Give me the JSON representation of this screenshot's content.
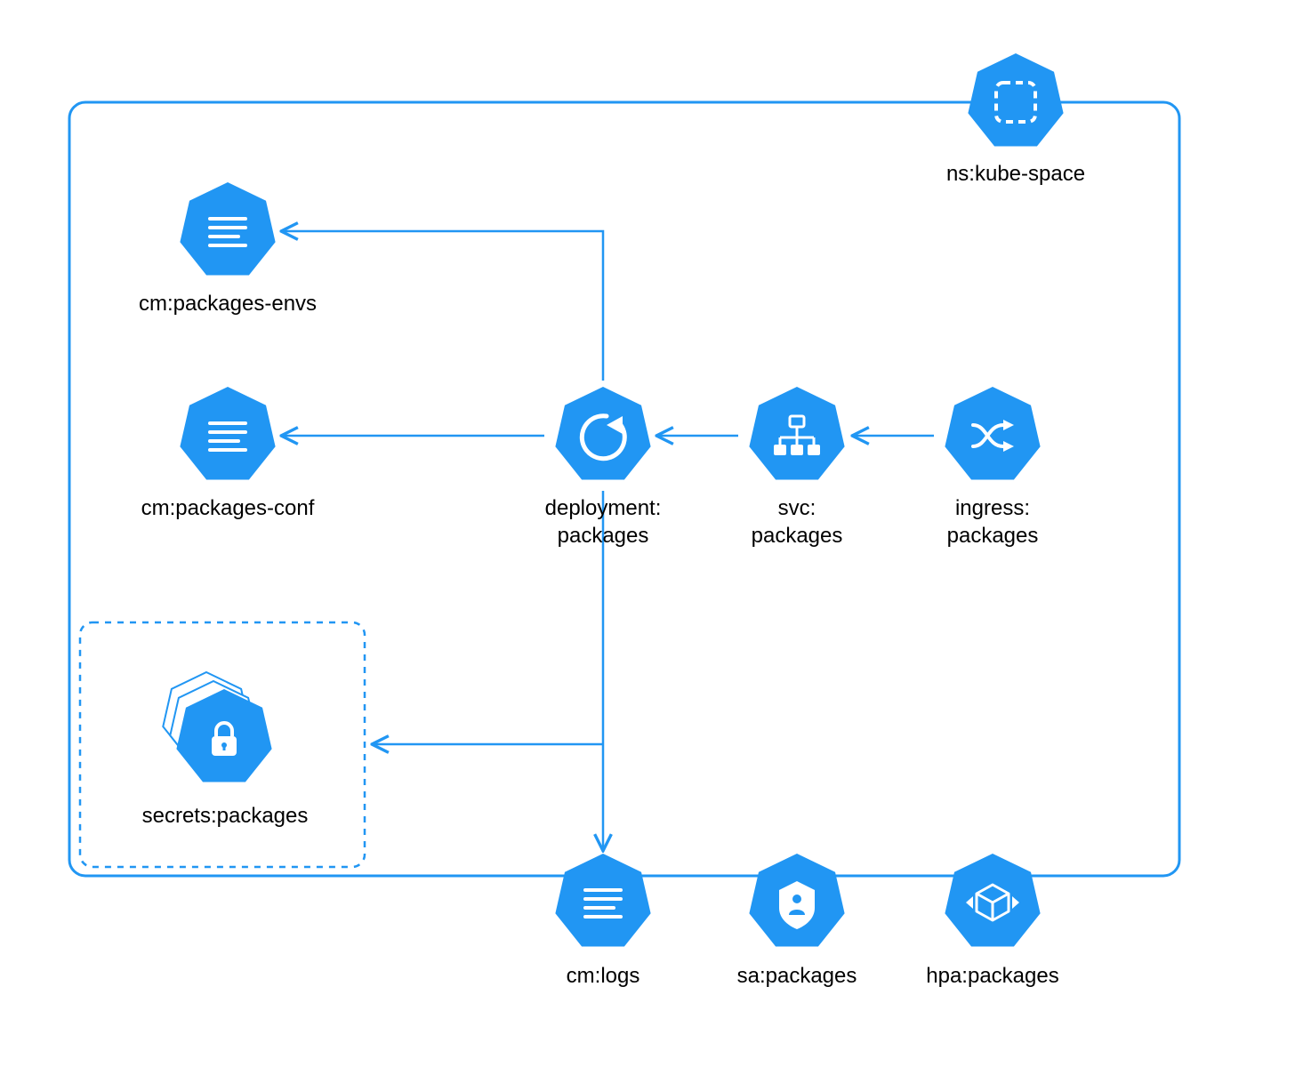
{
  "colors": {
    "blue": "#2196F3",
    "line": "#2196F3"
  },
  "nodes": {
    "namespace": {
      "label": "ns:kube-space"
    },
    "cm_envs": {
      "label": "cm:packages-envs"
    },
    "cm_conf": {
      "label": "cm:packages-conf"
    },
    "deployment": {
      "label": "deployment:\npackages"
    },
    "service": {
      "label": "svc:\npackages"
    },
    "ingress": {
      "label": "ingress:\npackages"
    },
    "secrets": {
      "label": "secrets:packages"
    },
    "cm_logs": {
      "label": "cm:logs"
    },
    "sa": {
      "label": "sa:packages"
    },
    "hpa": {
      "label": "hpa:packages"
    }
  }
}
